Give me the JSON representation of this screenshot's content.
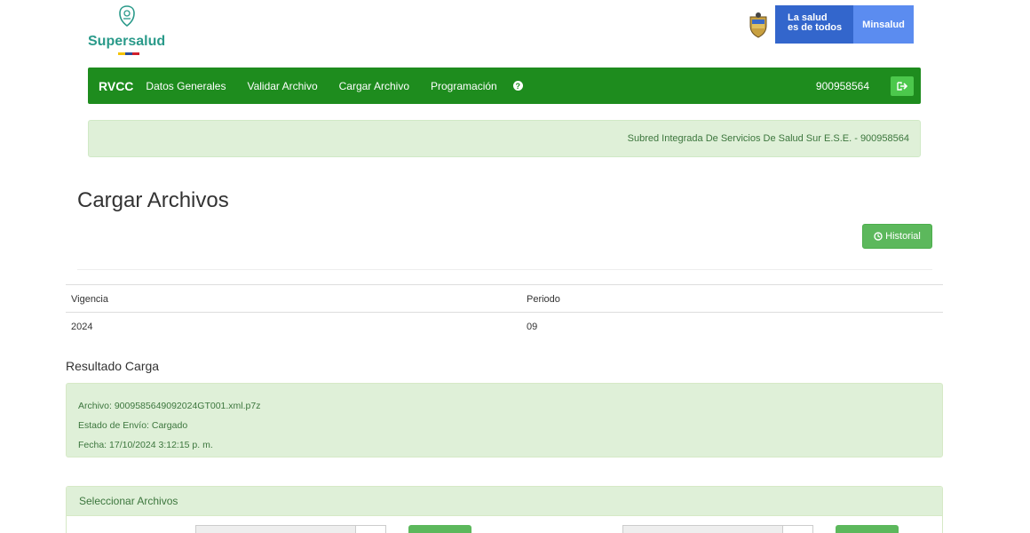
{
  "header": {
    "brand_name": "Supersalud",
    "gov_slogan_line1": "La salud",
    "gov_slogan_line2": "es de todos",
    "ministry": "Minsalud"
  },
  "navbar": {
    "brand": "RVCC",
    "items": [
      {
        "label": "Datos Generales"
      },
      {
        "label": "Validar Archivo"
      },
      {
        "label": "Cargar Archivo"
      },
      {
        "label": "Programación"
      }
    ],
    "help_icon": "question-circle-icon",
    "user_nit": "900958564",
    "logout_icon": "sign-out-icon"
  },
  "entity_banner": "Subred Integrada De Servicios De Salud Sur E.S.E. - 900958564",
  "page": {
    "title": "Cargar Archivos",
    "historial_label": "Historial"
  },
  "table": {
    "headers": [
      "Vigencia",
      "Periodo"
    ],
    "rows": [
      [
        "2024",
        "09"
      ]
    ]
  },
  "resultado": {
    "title": "Resultado Carga",
    "archivo": "Archivo: 9009585649092024GT001.xml.p7z",
    "estado": "Estado de Envío: Cargado",
    "fecha": "Fecha: 17/10/2024 3:12:15 p. m."
  },
  "panel": {
    "heading": "Seleccionar Archivos"
  },
  "colors": {
    "navbar": "#1e8c1e",
    "success_bg": "#dff0d8",
    "success_text": "#3c763d",
    "button_green": "#5cb85c"
  }
}
